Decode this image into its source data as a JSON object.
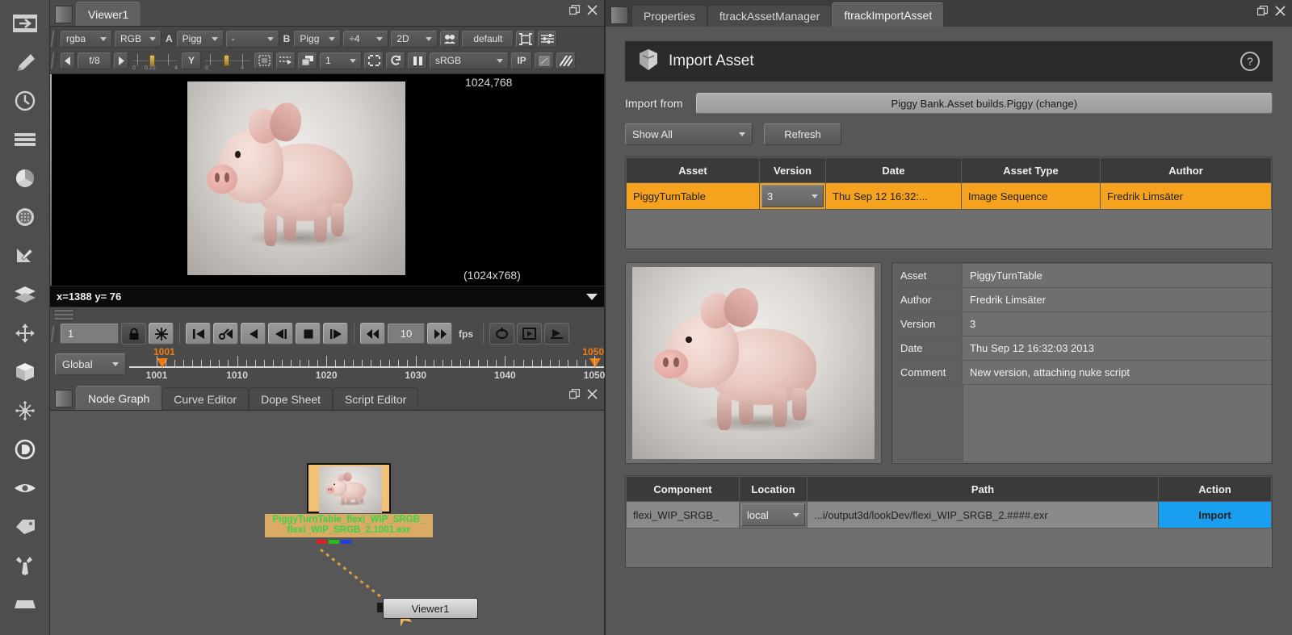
{
  "left_rail": {
    "icons": [
      {
        "name": "panel-insert-icon"
      },
      {
        "name": "paint-brush-icon"
      },
      {
        "name": "time-clock-icon"
      },
      {
        "name": "stack-lines-icon"
      },
      {
        "name": "color-wheel-icon"
      },
      {
        "name": "grain-circle-icon"
      },
      {
        "name": "keyer-pen-icon"
      },
      {
        "name": "layers-icon"
      },
      {
        "name": "transform-move-icon"
      },
      {
        "name": "cube-3d-icon"
      },
      {
        "name": "particles-icon"
      },
      {
        "name": "deep-icon"
      },
      {
        "name": "eye-views-icon"
      },
      {
        "name": "metadata-tag-icon"
      },
      {
        "name": "tools-wrench-icon"
      },
      {
        "name": "other-box-icon"
      }
    ]
  },
  "viewer_panel": {
    "tab": "Viewer1",
    "window_controls": {
      "float": "float-icon",
      "close": "close-icon"
    },
    "toolbar_row1": {
      "channels": "rgba",
      "layer": "RGB",
      "a_label": "A",
      "a_input": "Pigg",
      "blend": "-",
      "b_label": "B",
      "b_input": "Pigg",
      "proxy": "÷4",
      "mode": "2D",
      "stereo_icon": "stereo-icon",
      "viewer_process": "default",
      "gain_icon": "gain-icon",
      "sliders_icon": "sliders-icon"
    },
    "toolbar_row2": {
      "fstop": "f/8",
      "gamma_label": "Y",
      "gain_slider_min": "0",
      "gain_slider_mid": "0.25",
      "gain_slider_max": "4",
      "gamma_slider_min": "0",
      "gamma_slider_max": "4",
      "roi_icon": "roi-icon",
      "wipe_icon": "wipe-icon",
      "monitor_icon": "monitor-out-icon",
      "downres": "1",
      "clip_icon": "clipping-warning-icon",
      "refresh_icon": "refresh-icon",
      "pause_icon": "pause-icon",
      "colorspace": "sRGB",
      "ip_label": "IP",
      "alpha_icon": "alpha-overlay-icon",
      "stripes_icon": "stripes-icon"
    },
    "overlay_top_right": "1024,768",
    "overlay_bottom_right": "(1024x768)",
    "coord_readout": "x=1388 y=  76"
  },
  "transport": {
    "frame_value": "1",
    "lock_icon": "lock-icon",
    "snowflake_icon": "freeze-icon",
    "buttons": [
      {
        "name": "first-frame-button",
        "icon": "skip-start-icon"
      },
      {
        "name": "previous-keyframe-button",
        "icon": "prev-key-icon"
      },
      {
        "name": "play-backward-button",
        "icon": "play-back-icon"
      },
      {
        "name": "step-backward-button",
        "icon": "step-back-icon"
      },
      {
        "name": "stop-button",
        "icon": "stop-icon"
      },
      {
        "name": "step-forward-button",
        "icon": "step-forward-icon"
      }
    ],
    "fps_down_icon": "rewind-icon",
    "fps_value": "10",
    "fps_up_icon": "fast-forward-icon",
    "fps_label": "fps",
    "loop_icon": "loop-icon",
    "playonce_icon": "play-once-icon",
    "bounce_icon": "bounce-icon",
    "range_selector": "Global",
    "range_start_marker": "1001",
    "range_end_marker": "1050",
    "ruler": {
      "start": 1001,
      "end": 1050,
      "labels": [
        "1001",
        "1010",
        "1020",
        "1030",
        "1040",
        "1050"
      ],
      "label_values": [
        1001,
        1010,
        1020,
        1030,
        1040,
        1050
      ]
    }
  },
  "node_graph": {
    "tabs": [
      {
        "label": "Node Graph",
        "active": true
      },
      {
        "label": "Curve Editor",
        "active": false
      },
      {
        "label": "Dope Sheet",
        "active": false
      },
      {
        "label": "Script Editor",
        "active": false
      }
    ],
    "window_controls": {
      "float": "float-icon",
      "close": "close-icon"
    },
    "read_node": {
      "label_line1": "PiggyTurnTable_flexi_WIP_SRGB_",
      "label_line2": "flexi_WIP_SRGB_2.1001.exr",
      "label_color": "#37d24a",
      "node_color": "#f2c173",
      "channel_chips": [
        "#e02020",
        "#20c020",
        "#2040e0"
      ]
    },
    "viewer_node": {
      "label": "Viewer1"
    }
  },
  "right_panel": {
    "tabs": [
      {
        "label": "Properties",
        "active": false
      },
      {
        "label": "ftrackAssetManager",
        "active": false
      },
      {
        "label": "ftrackImportAsset",
        "active": true
      }
    ],
    "window_controls": {
      "float": "float-icon",
      "close": "close-icon"
    },
    "header": {
      "title": "Import Asset",
      "logo_icon": "ftrack-logo-icon",
      "help_icon": "help-question-icon"
    },
    "import_from": {
      "label": "Import from",
      "value": "Piggy Bank.Asset builds.Piggy (change)"
    },
    "filter": {
      "value": "Show All",
      "refresh_label": "Refresh"
    },
    "asset_table": {
      "columns": [
        "Asset",
        "Version",
        "Date",
        "Asset Type",
        "Author"
      ],
      "rows": [
        {
          "asset": "PiggyTurnTable",
          "version": "3",
          "date": "Thu Sep 12 16:32:...",
          "asset_type": "Image Sequence",
          "author": "Fredrik Limsäter",
          "selected": true
        }
      ]
    },
    "detail": {
      "preview_icon": "asset-preview-thumbnail",
      "fields": [
        {
          "key": "Asset",
          "value": "PiggyTurnTable"
        },
        {
          "key": "Author",
          "value": "Fredrik Limsäter"
        },
        {
          "key": "Version",
          "value": "3"
        },
        {
          "key": "Date",
          "value": "Thu Sep 12 16:32:03 2013"
        },
        {
          "key": "Comment",
          "value": "New version, attaching nuke script"
        }
      ]
    },
    "component_table": {
      "columns": [
        "Component",
        "Location",
        "Path",
        "Action"
      ],
      "rows": [
        {
          "component": "flexi_WIP_SRGB_",
          "location": "local",
          "path": "...i/output3d/lookDev/flexi_WIP_SRGB_2.####.exr",
          "action": "Import"
        }
      ]
    }
  },
  "colors": {
    "accent_orange": "#f5a21e",
    "import_blue": "#1a9ff0",
    "node_label_green": "#37d24a",
    "panel_bg": "#575757",
    "header_bg": "#2b2b2b"
  }
}
